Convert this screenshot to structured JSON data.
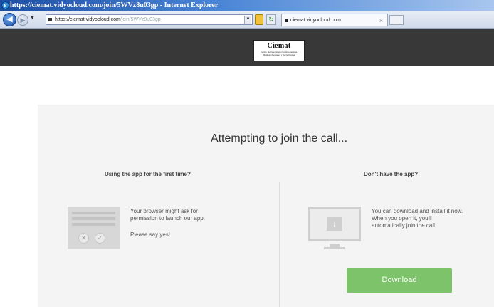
{
  "browser": {
    "window_title": "https://ciemat.vidyocloud.com/join/5WVz8u03gp - Internet Explorer",
    "address": {
      "prefix": "https://",
      "domain": "ciemat.vidyocloud.com",
      "path": "/join/5WVz8u03gp"
    },
    "tab_title": "ciemat.vidyocloud.com",
    "tab_close": "×"
  },
  "header": {
    "logo_name": "Ciemat",
    "logo_subtitle": "Centro de Investigaciones Energéticas, Medioambientales y Tecnológicas"
  },
  "main": {
    "title": "Attempting to join the call...",
    "left": {
      "heading": "Using the app for the first time?",
      "line1": "Your browser might ask for",
      "line2": "permission to launch our app.",
      "line3": "Please say yes!"
    },
    "right": {
      "heading": "Don't have the app?",
      "line1": "You can download and install it now.",
      "line2": "When you open it, you'll",
      "line3": "automatically join the call.",
      "download_label": "Download"
    }
  },
  "colors": {
    "header_bg": "#383838",
    "card_bg": "#f4f4f4",
    "download_button": "#7cc36a"
  }
}
